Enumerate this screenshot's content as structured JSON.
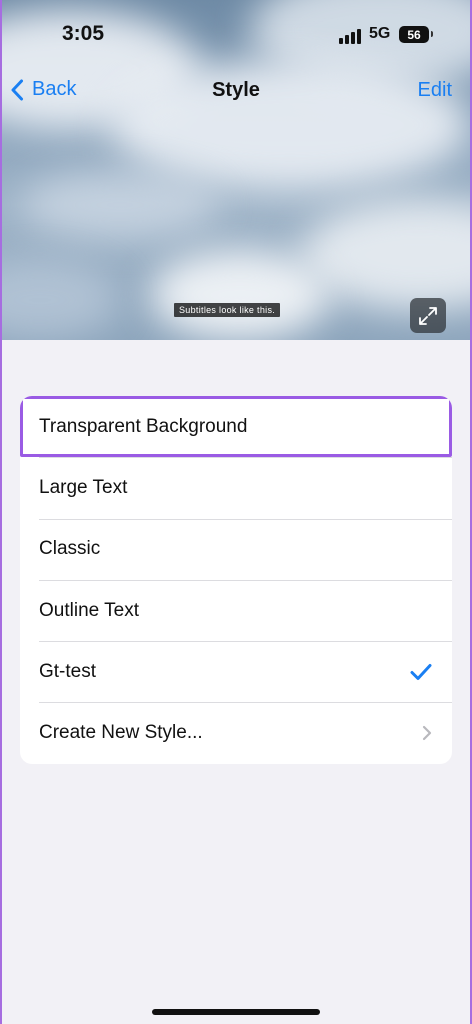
{
  "status_bar": {
    "time": "3:05",
    "network": "5G",
    "battery": "56"
  },
  "nav": {
    "back_label": "Back",
    "title": "Style",
    "edit_label": "Edit"
  },
  "preview": {
    "subtitle_text": "Subtitles look like this."
  },
  "styles": {
    "items": [
      {
        "label": "Transparent Background",
        "selected": false,
        "highlighted": true
      },
      {
        "label": "Large Text",
        "selected": false
      },
      {
        "label": "Classic",
        "selected": false
      },
      {
        "label": "Outline Text",
        "selected": false
      },
      {
        "label": "Gt-test",
        "selected": true,
        "trail_icon": "checkmark-icon"
      },
      {
        "label": "Create New Style...",
        "trail_icon": "chevron-right-icon"
      }
    ]
  },
  "colors": {
    "accent": "#1a7ff2",
    "highlight_outline": "#9a5be4",
    "background": "#f2f1f6"
  }
}
